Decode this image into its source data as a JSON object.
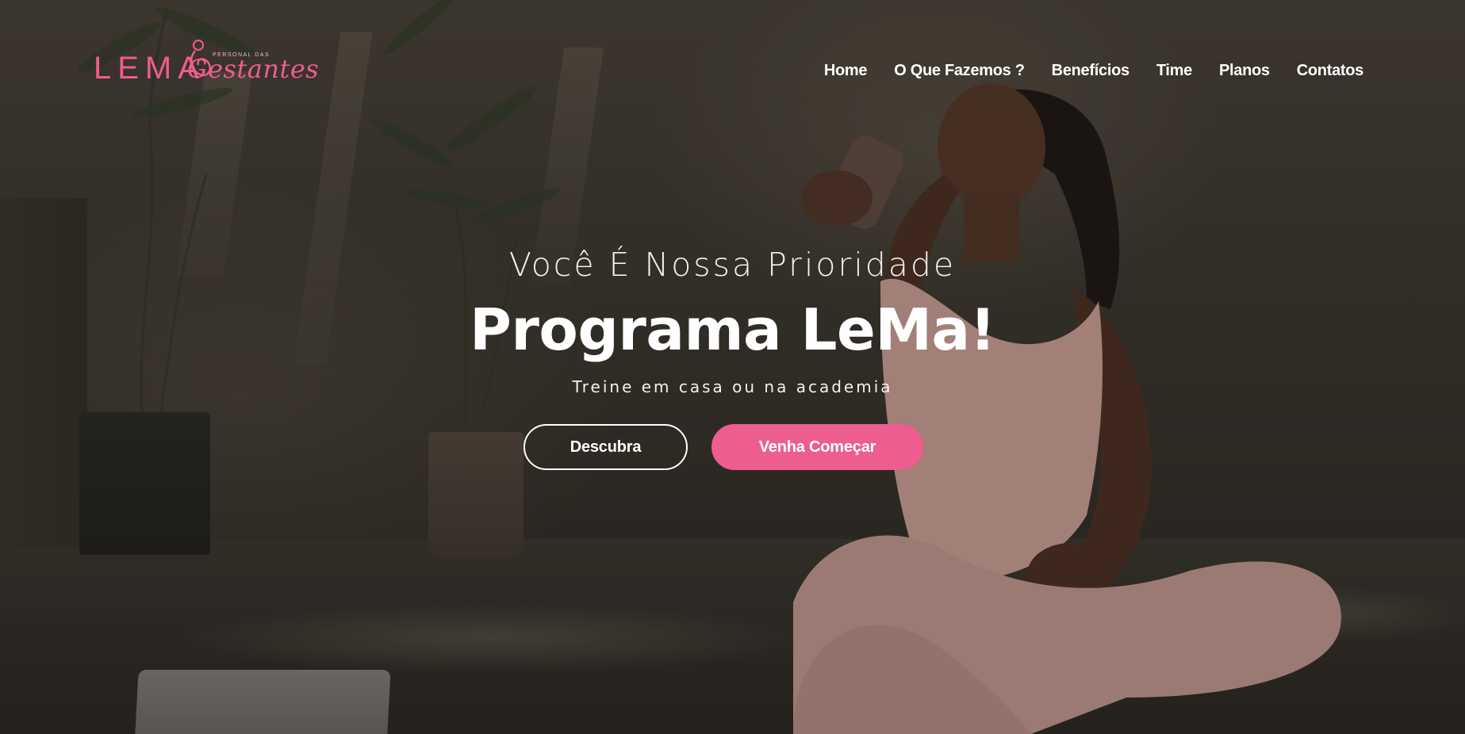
{
  "logo": {
    "brand": "LEMA",
    "script": "Gestantes",
    "tagline": "PERSONAL DAS"
  },
  "nav": {
    "items": [
      {
        "label": "Home"
      },
      {
        "label": "O Que Fazemos ?"
      },
      {
        "label": "Benefícios"
      },
      {
        "label": "Time"
      },
      {
        "label": "Planos"
      },
      {
        "label": "Contatos"
      }
    ]
  },
  "hero": {
    "eyebrow": "Você É Nossa Prioridade",
    "title": "Programa LeMa!",
    "subtitle": "Treine em casa ou na academia",
    "primary_button": "Descubra",
    "secondary_button": "Venha Começar"
  },
  "colors": {
    "accent": "#ee5d8f",
    "text": "#ffffff"
  }
}
